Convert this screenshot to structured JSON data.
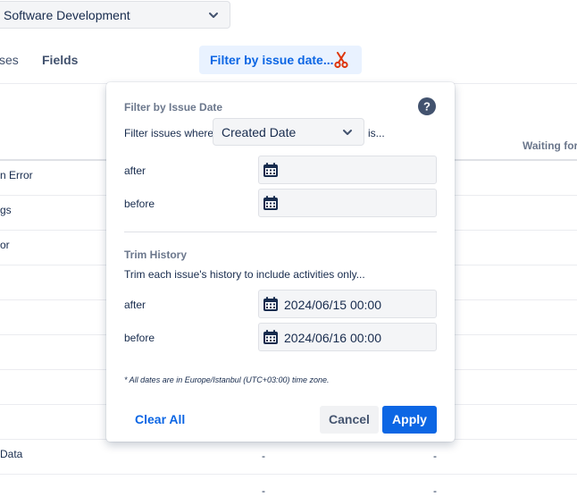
{
  "project_select": {
    "value": "Software Development"
  },
  "tabs": {
    "partial_left": "ses",
    "fields": "Fields"
  },
  "filter_button": {
    "label": "Filter by issue date..."
  },
  "table": {
    "column_header": "Waiting for",
    "rows": [
      {
        "label": "n Error"
      },
      {
        "label": "gs"
      },
      {
        "label": "or"
      },
      {
        "label": ""
      },
      {
        "label": ""
      },
      {
        "label": ""
      },
      {
        "label": ""
      },
      {
        "label": ""
      },
      {
        "label": "Data",
        "col_a": "-",
        "col_b": "-"
      },
      {
        "label": "",
        "col_a": "-",
        "col_b": "-"
      }
    ]
  },
  "popover": {
    "title": "Filter by Issue Date",
    "filter_where_label": "Filter issues where",
    "date_type": "Created Date",
    "is_label": "is...",
    "after_label": "after",
    "after_value": "",
    "before_label": "before",
    "before_value": "",
    "trim_title": "Trim History",
    "trim_description": "Trim each issue's history to include activities only...",
    "trim_after_label": "after",
    "trim_after_value": "2024/06/15 00:00",
    "trim_before_label": "before",
    "trim_before_value": "2024/06/16 00:00",
    "timezone_note": "* All dates are in Europe/Istanbul (UTC+03:00) time zone.",
    "clear_all": "Clear All",
    "cancel": "Cancel",
    "apply": "Apply"
  },
  "icons": {
    "dropdown": "chevron-down-icon",
    "scissors": "scissors-icon",
    "help": "help-icon",
    "calendar": "calendar-icon"
  },
  "colors": {
    "accent": "#0c66e4",
    "filter_button_bg": "#e9f2ff",
    "scissors": "#de350b"
  }
}
